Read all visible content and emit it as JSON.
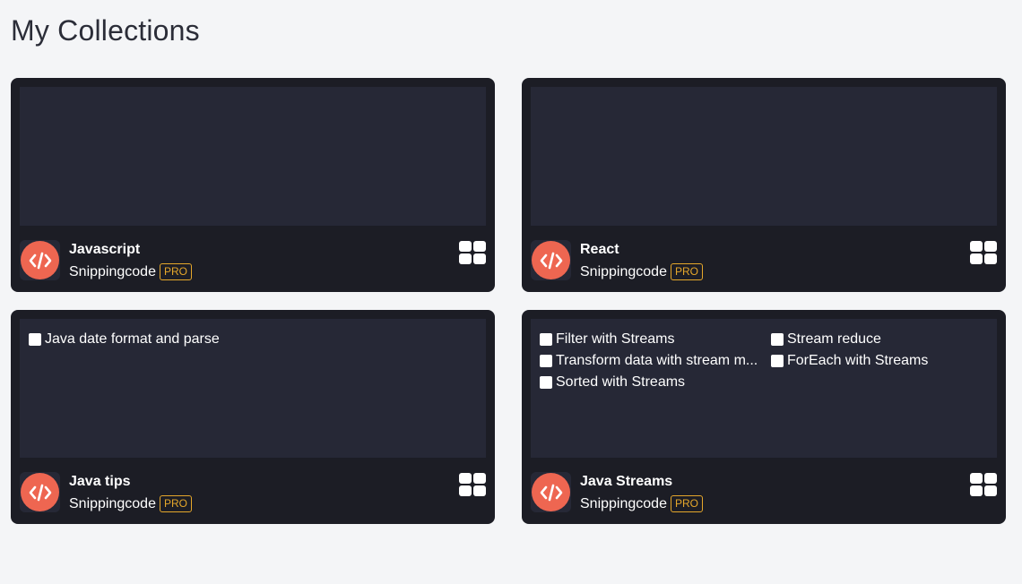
{
  "page": {
    "title": "My Collections"
  },
  "collections": [
    {
      "title": "Javascript",
      "owner": "Snippingcode",
      "badge": "PRO",
      "snippets": []
    },
    {
      "title": "React",
      "owner": "Snippingcode",
      "badge": "PRO",
      "snippets": []
    },
    {
      "title": "Java tips",
      "owner": "Snippingcode",
      "badge": "PRO",
      "snippets": [
        "Java date format and parse"
      ]
    },
    {
      "title": "Java Streams",
      "owner": "Snippingcode",
      "badge": "PRO",
      "snippets": [
        "Filter with Streams",
        "Stream reduce",
        "Transform data with stream m...",
        "ForEach with Streams",
        "Sorted with Streams"
      ]
    }
  ],
  "icons": {
    "logo": "code-brackets-icon",
    "view": "grid-view-icon"
  },
  "colors": {
    "background": "#f4f5f7",
    "card": "#1c1d25",
    "preview": "#262836",
    "logo": "#ee6651",
    "badge": "#e5a72b"
  }
}
